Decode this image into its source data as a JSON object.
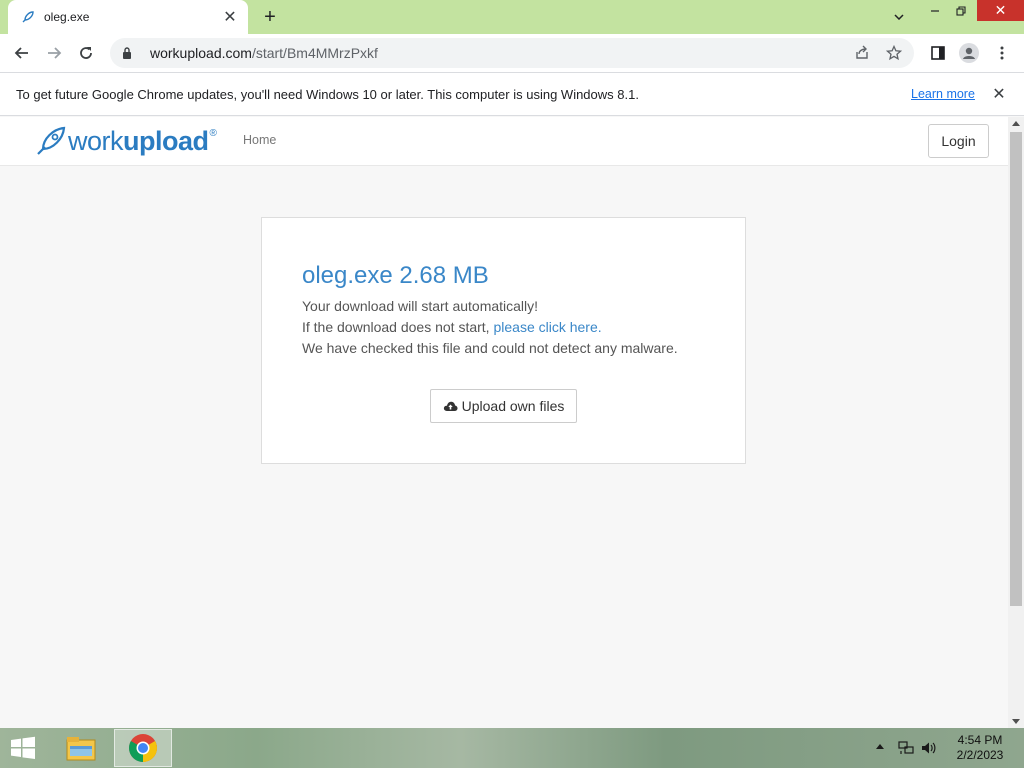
{
  "browser": {
    "tab": {
      "title": "oleg.exe",
      "favicon": "rocket-icon"
    },
    "window_controls": [
      "tab-search-icon",
      "minimize-icon",
      "restore-icon",
      "close-icon"
    ],
    "url": {
      "host": "workupload.com",
      "path": "/start/Bm4MMrzPxkf"
    },
    "infobar": {
      "text": "To get future Google Chrome updates, you'll need Windows 10 or later. This computer is using Windows 8.1.",
      "link": "Learn more"
    }
  },
  "site": {
    "logo": {
      "text_part1": "work",
      "text_part2": "upload",
      "reg": "®"
    },
    "nav": {
      "home": "Home"
    },
    "login_label": "Login"
  },
  "download": {
    "file_title": "oleg.exe 2.68 MB",
    "line1": "Your download will start automatically!",
    "line2_prefix": "If the download does not start, ",
    "line2_link": "please click here.",
    "line3": "We have checked this file and could not detect any malware.",
    "upload_label": "Upload own files"
  },
  "taskbar": {
    "apps": [
      "file-explorer-icon",
      "chrome-icon"
    ],
    "time": "4:54 PM",
    "date": "2/2/2023"
  },
  "colors": {
    "tabstrip": "#c3e3a0",
    "accent_blue": "#3a87c8",
    "close_red": "#c8322b"
  }
}
